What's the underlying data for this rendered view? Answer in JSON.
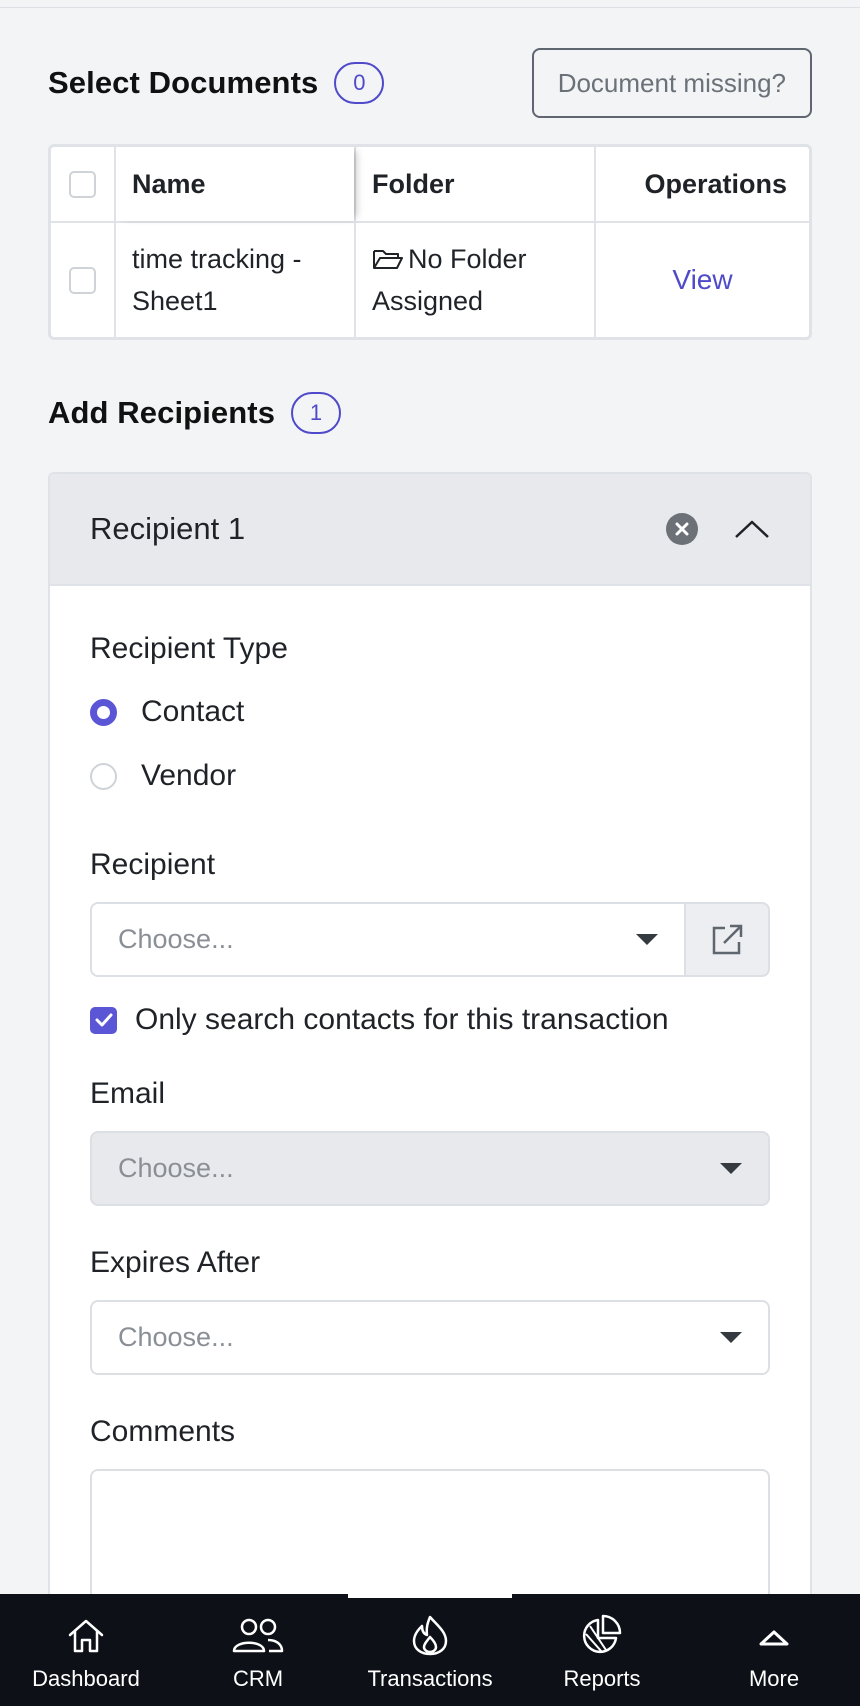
{
  "documents": {
    "title": "Select Documents",
    "count": "0",
    "missing_button": "Document missing?",
    "columns": {
      "name": "Name",
      "folder": "Folder",
      "operations": "Operations"
    },
    "rows": [
      {
        "name": "time tracking - Sheet1",
        "folder": "No Folder Assigned",
        "action": "View"
      }
    ]
  },
  "recipients": {
    "title": "Add Recipients",
    "count": "1",
    "card_title": "Recipient 1",
    "type_label": "Recipient Type",
    "type_options": [
      "Contact",
      "Vendor"
    ],
    "type_selected": "Contact",
    "recipient_label": "Recipient",
    "recipient_placeholder": "Choose...",
    "only_search_label": "Only search contacts for this transaction",
    "only_search_checked": true,
    "email_label": "Email",
    "email_placeholder": "Choose...",
    "expires_label": "Expires After",
    "expires_placeholder": "Choose...",
    "comments_label": "Comments"
  },
  "nav": {
    "items": [
      {
        "label": "Dashboard",
        "icon": "home-icon"
      },
      {
        "label": "CRM",
        "icon": "users-icon"
      },
      {
        "label": "Transactions",
        "icon": "flame-icon"
      },
      {
        "label": "Reports",
        "icon": "pie-chart-icon"
      },
      {
        "label": "More",
        "icon": "chevron-up-icon"
      }
    ]
  },
  "colors": {
    "accent": "#4f4ac9",
    "nav_bg": "#0d1117",
    "page_bg": "#f3f4f6"
  }
}
